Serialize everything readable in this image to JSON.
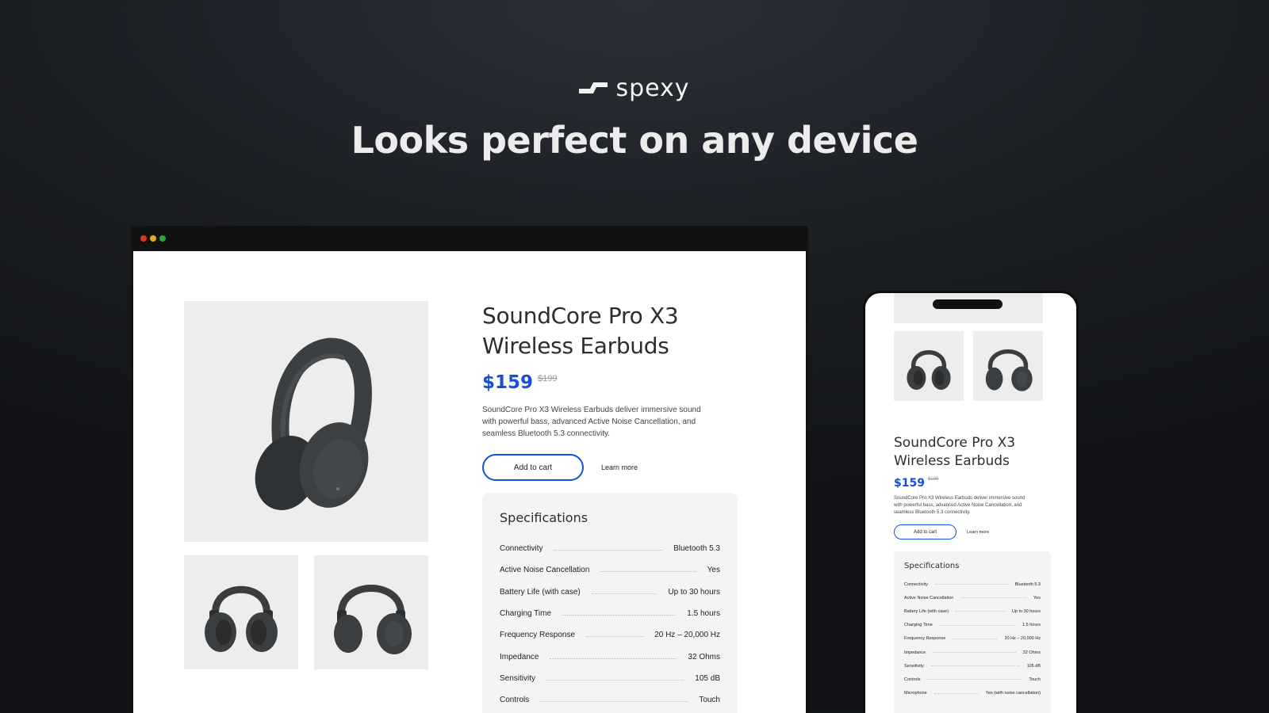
{
  "brand": {
    "name": "spexy"
  },
  "headline": "Looks perfect on any device",
  "colors": {
    "accent": "#1450d8",
    "dot_red": "#e0302a",
    "dot_yellow": "#e9a81c",
    "dot_green": "#2aa53a",
    "background": "#1a1d22"
  },
  "product": {
    "title_line1": "SoundCore Pro X3",
    "title_line2": "Wireless Earbuds",
    "price": "$159",
    "old_price": "$199",
    "description": "SoundCore Pro X3 Wireless Earbuds deliver immersive sound with powerful bass, advanced Active Noise Cancellation, and seamless Bluetooth 5.3 connectivity.",
    "add_to_cart": "Add to cart",
    "learn_more": "Learn more"
  },
  "specs": {
    "title": "Specifications",
    "rows": [
      {
        "label": "Connectivity",
        "value": "Bluetooth 5.3"
      },
      {
        "label": "Active Noise Cancellation",
        "value": "Yes"
      },
      {
        "label": "Battery Life (with case)",
        "value": "Up to 30 hours"
      },
      {
        "label": "Charging Time",
        "value": "1.5 hours"
      },
      {
        "label": "Frequency Response",
        "value": "20 Hz – 20,000 Hz"
      },
      {
        "label": "Impedance",
        "value": "32 Ohms"
      },
      {
        "label": "Sensitivity",
        "value": "105 dB"
      },
      {
        "label": "Controls",
        "value": "Touch"
      },
      {
        "label": "Microphone",
        "value": "Yes (with noise cancellation)"
      }
    ]
  }
}
